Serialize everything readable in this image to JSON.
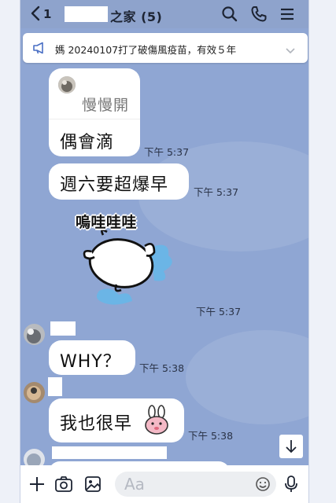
{
  "header": {
    "back_label": "<",
    "unread_count": "1",
    "title": "之家 (5)",
    "icons": [
      "search-icon",
      "phone-icon",
      "menu-icon"
    ]
  },
  "notice": {
    "text": "媽 20240107打了破傷風疫苗，有效５年"
  },
  "messages": [
    {
      "reply_quote": "慢慢開",
      "text": "偶會滴",
      "time": "下午 5:37"
    },
    {
      "text": "週六要超爆早",
      "time": "下午 5:37"
    },
    {
      "sticker_text": "嗚哇哇哇",
      "time": "下午 5:37"
    },
    {
      "text": "WHY？",
      "time": "下午 5:38"
    },
    {
      "text": "我也很早",
      "time": "下午 5:38"
    }
  ],
  "input": {
    "placeholder": "Aa"
  },
  "colors": {
    "chat_background": "#8fa6d3",
    "header_background": "#8ea3cc",
    "bubble": "#ffffff",
    "text": "#111111"
  }
}
